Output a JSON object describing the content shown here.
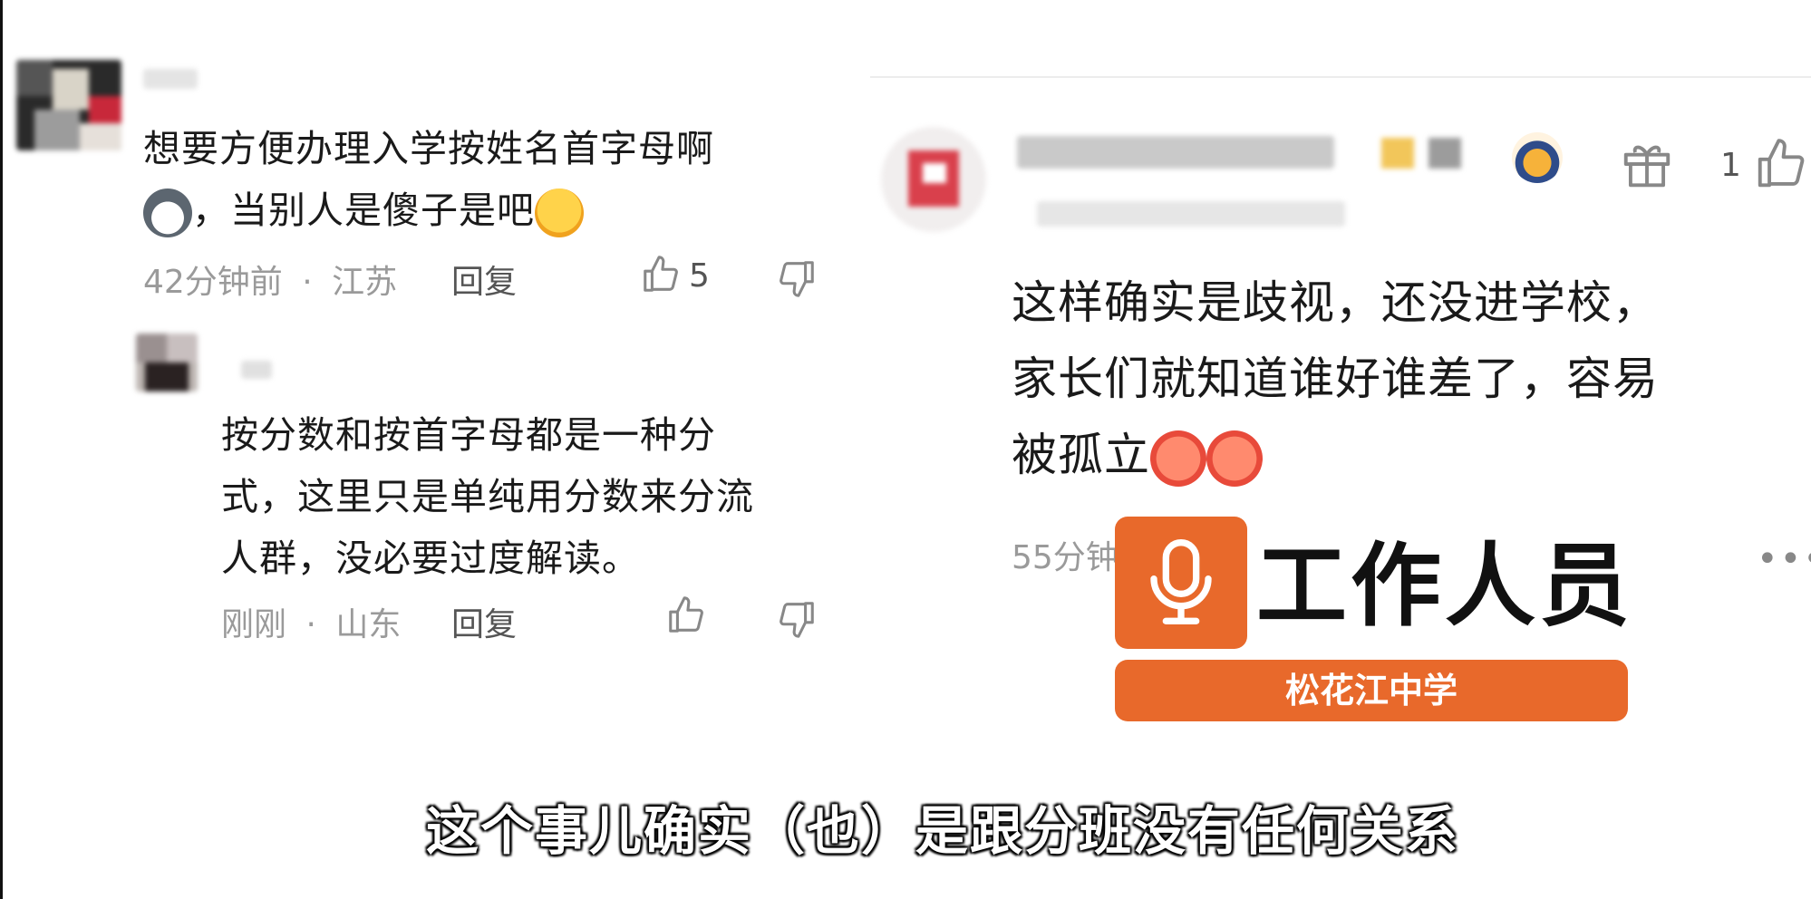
{
  "left_comment": {
    "text_line1": "想要方便办理入学按姓名首字母啊",
    "text_line2": "，当别人是傻子是吧",
    "time": "42分钟前",
    "location": "江苏",
    "reply_label": "回复",
    "like_count": "5"
  },
  "left_reply": {
    "text_line1": "按分数和按首字母都是一种分",
    "text_line2": "式，这里只是单纯用分数来分流",
    "text_line3": "人群，没必要过度解读。",
    "time": "刚刚",
    "location": "山东",
    "reply_label": "回复"
  },
  "right_comment": {
    "like_count": "1",
    "text_line1": "这样确实是歧视，还没进学校，",
    "text_line2": "家长们就知道谁好谁差了，容易",
    "text_line3": "被孤立",
    "time_partial": "55分钟"
  },
  "badge": {
    "title": "工作人员",
    "school": "松花江中学",
    "color": "#e8692b"
  },
  "subtitle": "这个事儿确实（也）是跟分班没有任何关系",
  "separator": "·"
}
